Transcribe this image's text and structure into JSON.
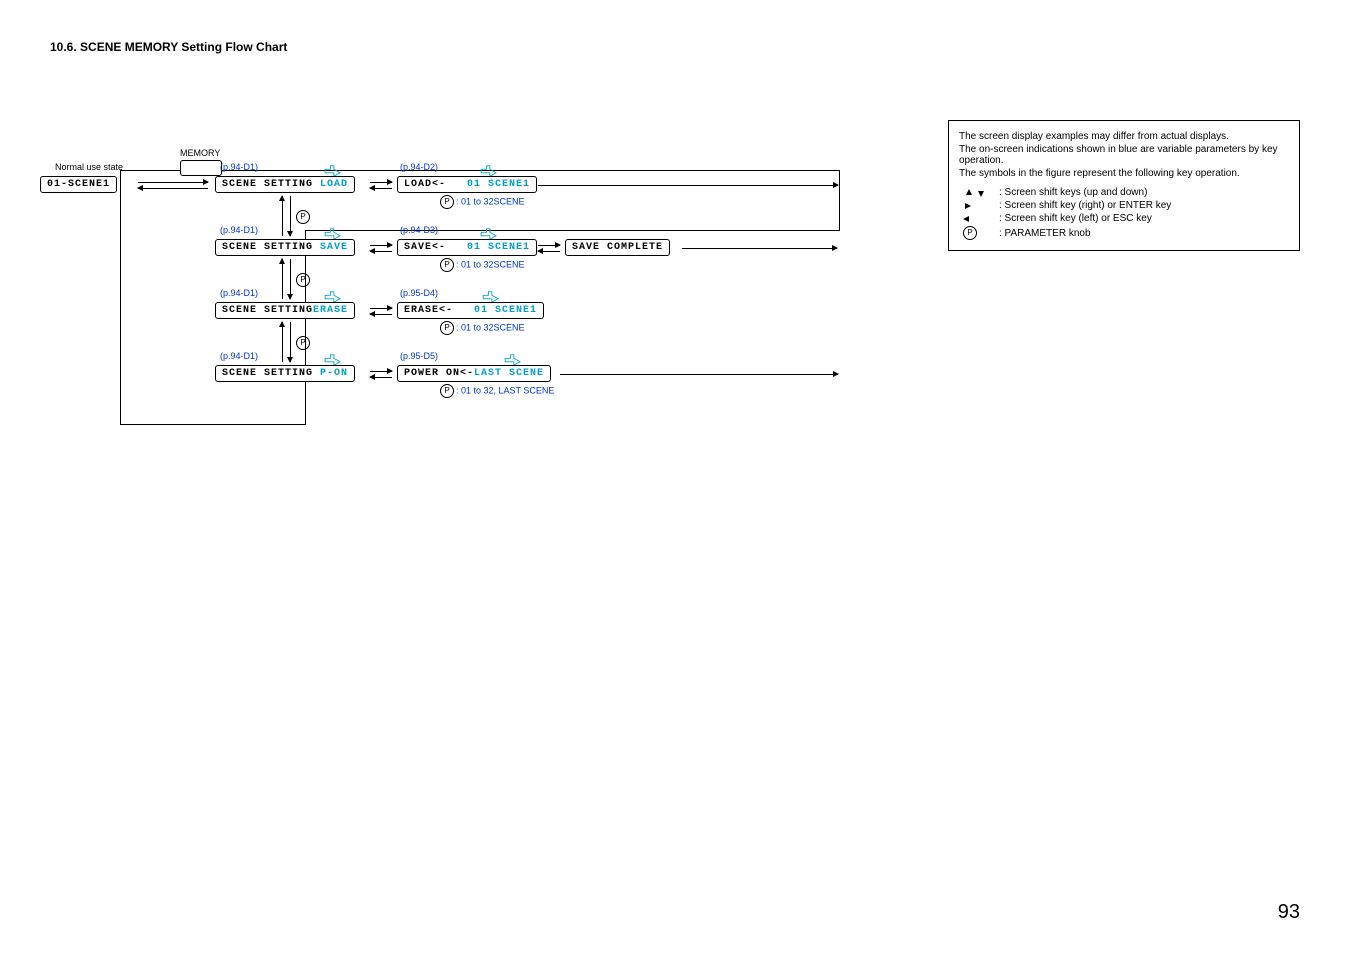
{
  "section_title": "10.6. SCENE MEMORY Setting Flow Chart",
  "normal_use_label": "Normal use state",
  "memory_label": "MEMORY",
  "start_lcd": "01-SCENE1",
  "refs": {
    "d1": "(p.94-D1)",
    "d2": "(p.94-D2)",
    "d3": "(p.94-D3)",
    "d4": "(p.95-D4)",
    "d5": "(p.95-D5)"
  },
  "rows": {
    "load": {
      "left_prefix": "SCENE SETTING ",
      "left_var": "LOAD",
      "right_prefix": "LOAD<-",
      "right_var": "01 SCENE1"
    },
    "save": {
      "left_prefix": "SCENE SETTING ",
      "left_var": "SAVE",
      "right_prefix": "SAVE<-",
      "right_var": "01 SCENE1",
      "result": "SAVE COMPLETE"
    },
    "erase": {
      "left_prefix": "SCENE SETTING",
      "left_var": "ERASE",
      "right_prefix": "ERASE<-",
      "right_var": "01 SCENE1"
    },
    "pon": {
      "left_prefix": "SCENE SETTING ",
      "left_var": "P-ON",
      "right_prefix": "POWER ON<-",
      "right_var": "LAST SCENE"
    }
  },
  "p_notes": {
    "range32": ": 01 to 32SCENE",
    "range_last": ": 01 to 32, LAST SCENE"
  },
  "legend": {
    "line1": "The screen display examples may differ from actual displays.",
    "line2": "The on-screen indications shown in blue are variable parameters by key operation.",
    "line3": "The symbols in the figure represent the following key operation.",
    "items": {
      "updown": ": Screen shift keys (up and down)",
      "right": ": Screen shift key (right) or ENTER key",
      "left": ": Screen shift key (left) or ESC key",
      "p": ": PARAMETER knob"
    }
  },
  "page_number": "93"
}
